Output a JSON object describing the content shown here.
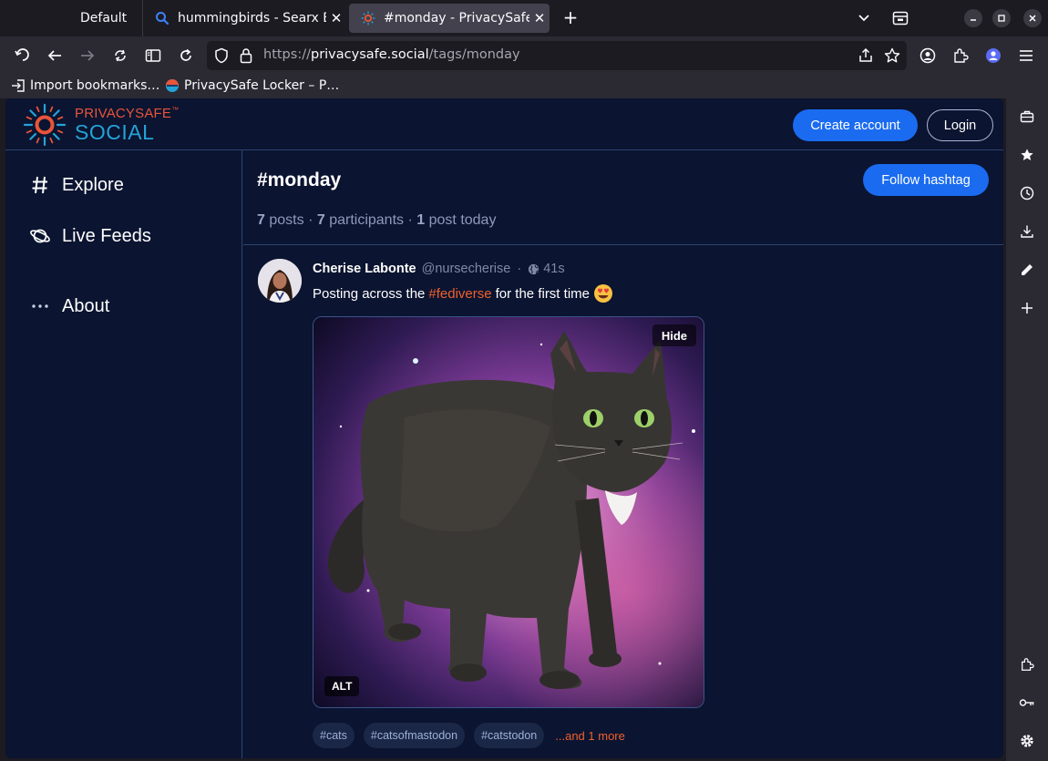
{
  "browser": {
    "tabs": [
      {
        "label": "Default"
      },
      {
        "label": "hummingbirds - Searx Be"
      },
      {
        "label": "#monday - PrivacySafe Sc",
        "active": true
      }
    ],
    "url": {
      "prefix": "https://",
      "domain": "privacysafe.social",
      "path": "/tags/monday"
    },
    "bookmarks": [
      {
        "label": "Import bookmarks…"
      },
      {
        "label": "PrivacySafe Locker – P…"
      }
    ],
    "icons": {
      "back": "back-arrow-icon",
      "forward": "forward-arrow-icon",
      "reload": "reload-icon",
      "shield": "shield-icon",
      "lock": "lock-icon",
      "share": "share-icon",
      "star": "star-icon"
    }
  },
  "site": {
    "logo": {
      "top": "PRIVACYSAFE",
      "tm": "™",
      "bottom": "SOCIAL"
    },
    "header": {
      "create_account": "Create account",
      "login": "Login"
    },
    "nav": [
      {
        "label": "Explore",
        "icon": "hash-icon"
      },
      {
        "label": "Live Feeds",
        "icon": "planet-icon"
      },
      {
        "label": "About",
        "icon": "ellipsis-icon"
      }
    ]
  },
  "hashtag": {
    "title": "#monday",
    "follow": "Follow hashtag",
    "stats": {
      "posts_n": "7",
      "posts_label": "posts",
      "participants_n": "7",
      "participants_label": "participants",
      "today_n": "1",
      "today_label": "post today",
      "sep": "·"
    }
  },
  "post": {
    "author": "Cherise Labonte",
    "handle": "@nursecherise",
    "time": "41s",
    "text_before": "Posting across the",
    "text_tag": "#fediverse",
    "text_after": "for the first time",
    "emoji": "😍",
    "media": {
      "hide": "Hide",
      "alt": "ALT"
    },
    "tags": [
      "#cats",
      "#catsofmastodon",
      "#catstodon"
    ],
    "more": "...and 1 more"
  },
  "colors": {
    "accent": "#1a6bf0",
    "hashtag": "#f0602d",
    "background": "#0b1430"
  }
}
